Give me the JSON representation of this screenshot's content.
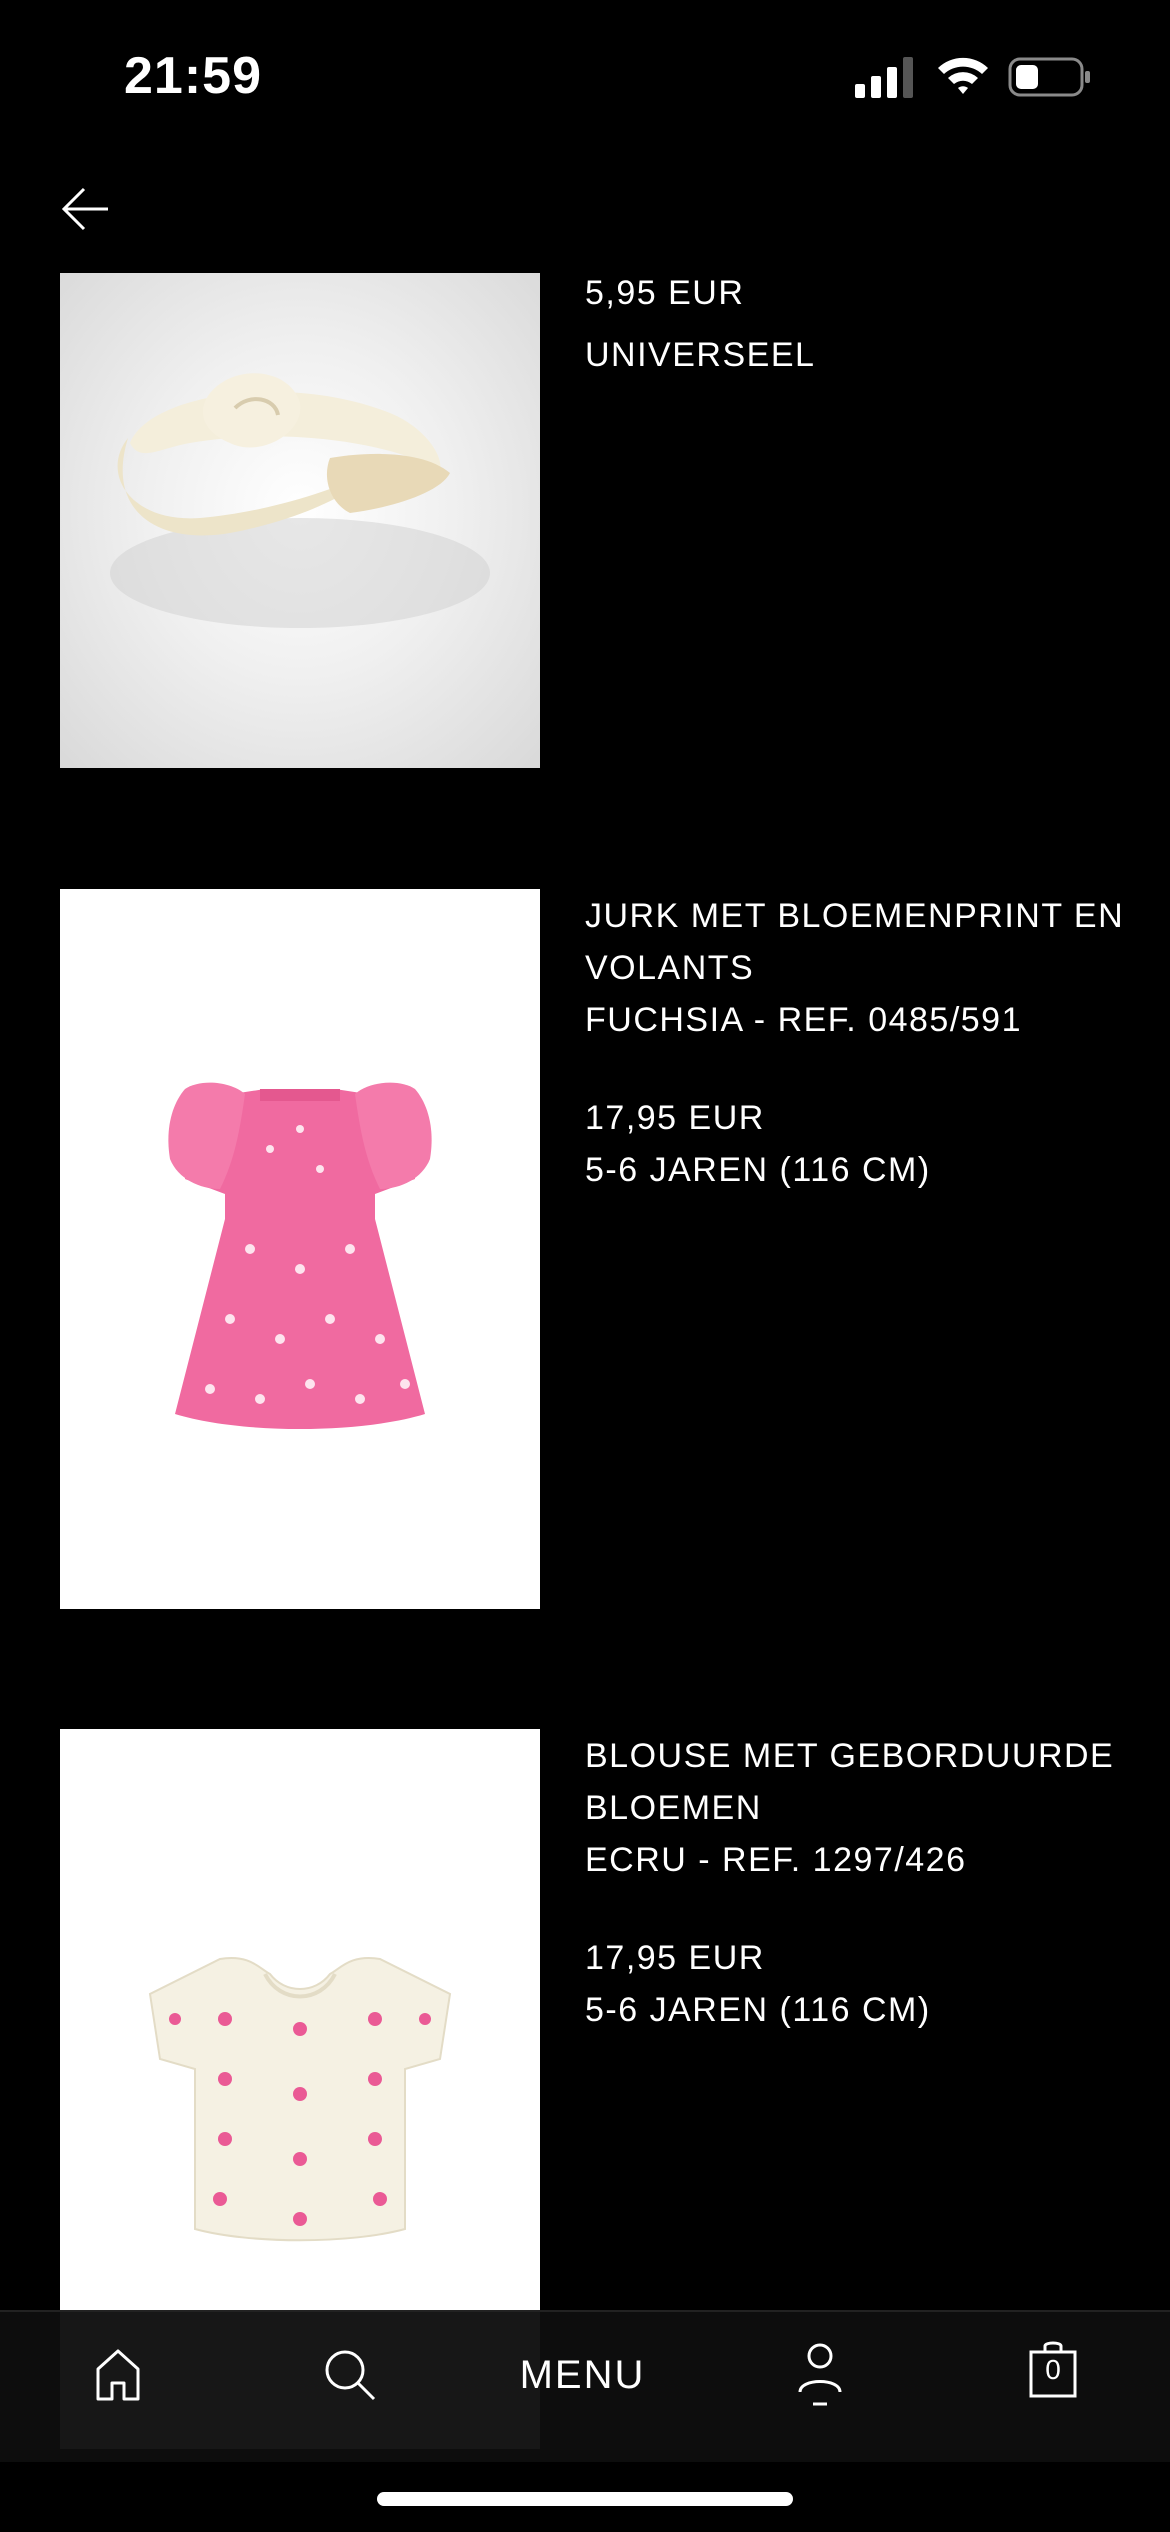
{
  "status_bar": {
    "time": "21:59",
    "signal_icon": "cellular-signal-icon",
    "wifi_icon": "wifi-icon",
    "battery_icon": "battery-icon",
    "battery_level": 0.3
  },
  "nav": {
    "back_icon": "arrow-left-icon"
  },
  "items": [
    {
      "image": "cream-knotted-headband",
      "price": "5,95 EUR",
      "size": "UNIVERSEEL"
    },
    {
      "image": "pink-floral-ruffle-dress",
      "name": "JURK MET BLOEMENPRINT EN VOLANTS",
      "color_ref": "FUCHSIA - REF. 0485/591",
      "price": "17,95 EUR",
      "size": "5-6 JAREN (116 CM)"
    },
    {
      "image": "ecru-embroidered-blouse",
      "name": "BLOUSE MET GEBORDUURDE BLOEMEN",
      "color_ref": "ECRU - REF. 1297/426",
      "price": "17,95 EUR",
      "size": "5-6 JAREN (116 CM)"
    }
  ],
  "tab_bar": {
    "home_icon": "home-icon",
    "search_icon": "search-icon",
    "menu_label": "MENU",
    "account_icon": "user-icon",
    "cart_icon": "shopping-bag-icon",
    "cart_count": "0"
  },
  "colors": {
    "background": "#000000",
    "text": "#ffffff",
    "dress_pink": "#f06aa0",
    "blouse_ecru": "#f5f1e3"
  }
}
